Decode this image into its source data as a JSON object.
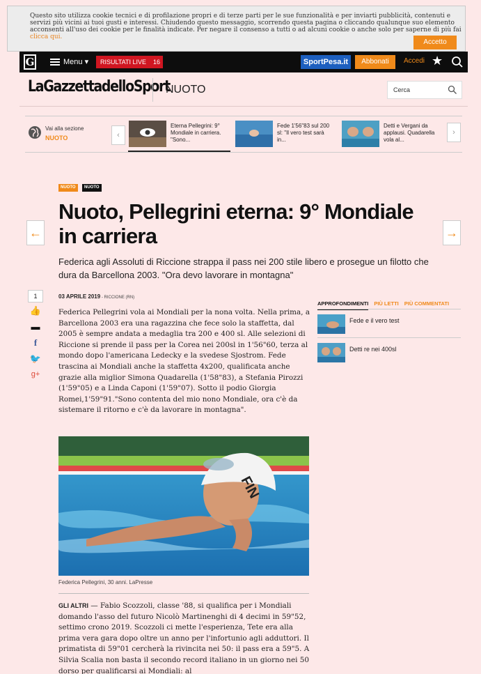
{
  "cookie_banner": {
    "text": "Questo sito utilizza cookie tecnici e di profilazione propri e di terze parti per le sue funzionalità e per inviarti pubblicità, contenuti e servizi più vicini ai tuoi gusti e interessi. Chiudendo questo messaggio, scorrendo questa pagina o cliccando qualunque suo elemento acconsenti all'uso dei cookie per le finalità indicate. Per negare il consenso a tutti o ad alcuni cookie o anche solo per saperne di più fai",
    "link": "clicca qui.",
    "accept_label": "Accetto"
  },
  "topbar": {
    "logo": "G",
    "menu_label": "Menu ▾",
    "live_label": "RISULTATI LIVE",
    "live_count": "16",
    "sportpesa_label": "SportPesa.it",
    "abbonati_label": "Abbonati",
    "accedi_label": "Accedi"
  },
  "header": {
    "brand": "LaGazzettadelloSport",
    "section": "NUOTO",
    "search_placeholder": "Cerca"
  },
  "related": {
    "vai_label": "Vai alla sezione",
    "section_label": "NUOTO",
    "items": [
      {
        "text": "Eterna Pellegrini: 9° Mondiale in carriera. \"Sono..."
      },
      {
        "text": "Fede 1'56\"83 sul 200 sl: \"Il vero test sarà in..."
      },
      {
        "text": "Detti e Vergani da applausi. Quadarella vola al..."
      }
    ]
  },
  "article": {
    "tags": [
      "NUOTO",
      "NUOTO"
    ],
    "title": "Nuoto, Pellegrini eterna: 9° Mondiale in carriera",
    "subtitle": "Federica agli Assoluti di Riccione strappa il pass nei 200 stile libero e prosegue un filotto che dura da Barcellona 2003. \"Ora devo lavorare in montagna\"",
    "date": "03 APRILE 2019",
    "location": " - RICCIONE (RN)",
    "paragraph1": "Federica Pellegrini vola ai Mondiali per la nona volta. Nella prima, a Barcellona 2003 era una ragazzina che fece solo la staffetta, dal 2005 è sempre andata a medaglia tra 200 e 400 sl. Alle selezioni di Riccione si prende il pass per la Corea nei 200sl in 1'56\"60, terza al mondo dopo l'americana Ledecky e la svedese Sjostrom. Fede trascina ai Mondiali anche la staffetta 4x200, qualificata anche grazie alla miglior Simona Quadarella (1'58\"83), a Stefania Pirozzi (1'59\"05) e a Linda Caponi (1'59\"07). Sotto il podio Giorgia Romei,1'59\"91.\"Sono contenta del mio nono Mondiale, ora c'è da sistemare il ritorno e c'è da lavorare in montagna\".",
    "caption": "Federica Pellegrini, 30 anni. LaPresse",
    "lead": "GLI ALTRI",
    "paragraph2": " — Fabio Scozzoli, classe '88, si qualifica per i Mondiali domando l'asso del futuro Nicolò Martinenghi di 4 decimi in 59\"52, settimo crono 2019. Scozzoli ci mette l'esperienza, Tete era alla prima vera gara dopo oltre un anno per l'infortunio agli adduttori. Il primatista di 59\"01 cercherà la rivincita nei 50: il pass era a 59\"5. A Silvia Scalia non basta il secondo record italiano in un giorno nei 50 dorso per qualificarsi ai Mondiali: al",
    "share_count": "1"
  },
  "sidebar": {
    "tabs": [
      "APPROFONDIMENTI",
      "PIÙ LETTI",
      "PIÙ COMMENTATI"
    ],
    "items": [
      {
        "text": "Fede e il vero test"
      },
      {
        "text": "Detti re nei 400sl"
      }
    ]
  },
  "colors": {
    "background": "#fde8e8",
    "accent": "#f08a1a",
    "live_red": "#d01621",
    "sportpesa_blue": "#1d5fbf"
  }
}
